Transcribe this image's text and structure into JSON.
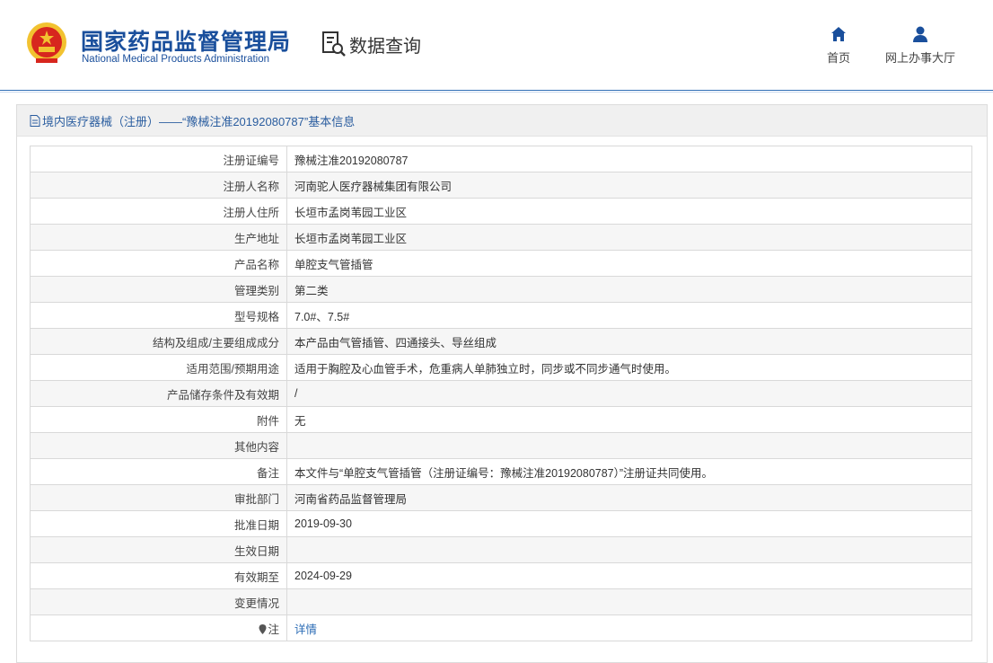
{
  "header": {
    "brand_cn": "国家药品监督管理局",
    "brand_en": "National Medical Products Administration",
    "data_query": "数据查询",
    "nav_home": "首页",
    "nav_hall": "网上办事大厅"
  },
  "panel": {
    "title": "境内医疗器械（注册）——“豫械注准20192080787”基本信息"
  },
  "rows": [
    {
      "label": "注册证编号",
      "value": "豫械注准20192080787"
    },
    {
      "label": "注册人名称",
      "value": "河南驼人医疗器械集团有限公司"
    },
    {
      "label": "注册人住所",
      "value": "长垣市孟岗苇园工业区"
    },
    {
      "label": "生产地址",
      "value": "长垣市孟岗苇园工业区"
    },
    {
      "label": "产品名称",
      "value": "单腔支气管插管"
    },
    {
      "label": "管理类别",
      "value": "第二类"
    },
    {
      "label": "型号规格",
      "value": "7.0#、7.5#"
    },
    {
      "label": "结构及组成/主要组成成分",
      "value": "本产品由气管插管、四通接头、导丝组成"
    },
    {
      "label": "适用范围/预期用途",
      "value": "适用于胸腔及心血管手术，危重病人单肺独立时，同步或不同步通气时使用。"
    },
    {
      "label": "产品储存条件及有效期",
      "value": "/"
    },
    {
      "label": "附件",
      "value": "无"
    },
    {
      "label": "其他内容",
      "value": ""
    },
    {
      "label": "备注",
      "value": "本文件与“单腔支气管插管（注册证编号：豫械注准20192080787）”注册证共同使用。"
    },
    {
      "label": "审批部门",
      "value": "河南省药品监督管理局"
    },
    {
      "label": "批准日期",
      "value": "2019-09-30"
    },
    {
      "label": "生效日期",
      "value": ""
    },
    {
      "label": "有效期至",
      "value": "2024-09-29"
    },
    {
      "label": "变更情况",
      "value": ""
    }
  ],
  "note_row": {
    "label": "注",
    "link": "详情"
  },
  "colors": {
    "brand": "#1a4f9c",
    "link": "#2a6bb5",
    "emblem_red": "#d7261e",
    "emblem_gold": "#f2c230"
  }
}
